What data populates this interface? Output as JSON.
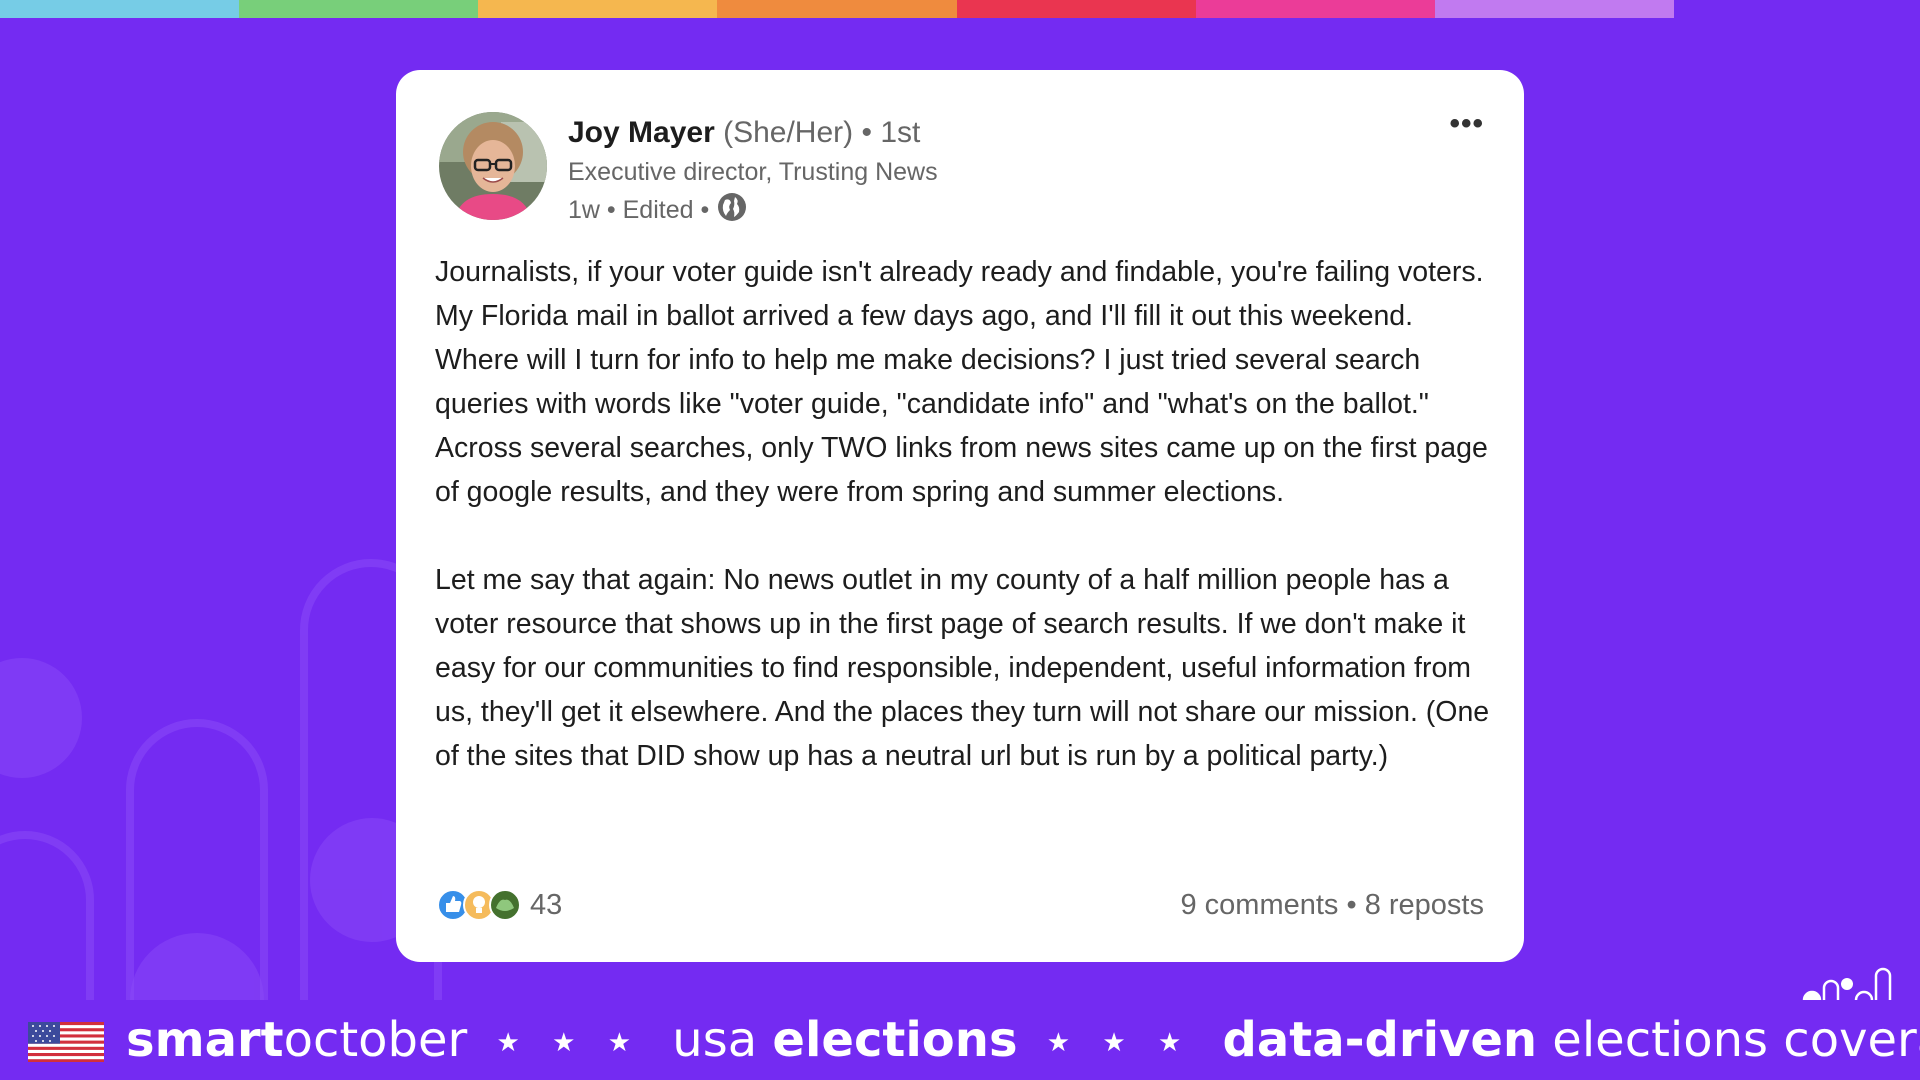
{
  "colors": {
    "background": "#742bf2",
    "card": "#ffffff",
    "rainbow": [
      "#76cce6",
      "#78cf7a",
      "#f5b74f",
      "#ef8b3e",
      "#ea3550",
      "#eb3c98",
      "#c17af0"
    ]
  },
  "post": {
    "author": {
      "name": "Joy Mayer",
      "pronouns": "(She/Her)",
      "degree": "1st",
      "headline": "Executive director, Trusting News"
    },
    "meta": {
      "time": "1w",
      "edited": "Edited"
    },
    "paragraphs": [
      "Journalists, if your voter guide isn't already ready and findable, you're failing voters. My Florida mail in ballot arrived a few days ago, and I'll fill it out this weekend. Where will I turn for info to help me make decisions? I just tried several search queries with words like \"voter guide, \"candidate info\" and \"what's on the ballot.\" Across several searches, only TWO links from news sites came up on the first page of google results, and they were from spring and summer elections.",
      "Let me say that again: No news outlet in my county of a half million people has a voter resource that shows up in the first page of search results. If we don't make it easy for our communities to find responsible, independent, useful information from us, they'll get it elsewhere. And the places they turn will not share our mission. (One of the sites that DID show up has a neutral url but is run by a political party.)"
    ],
    "reaction_count": "43",
    "reaction_icons": [
      "like-icon",
      "insightful-icon",
      "support-icon"
    ],
    "comments": "9 comments",
    "reposts": "8 reposts",
    "more_label": "•••"
  },
  "banner": {
    "smart": "smart",
    "october": "october",
    "stars": "★ ★ ★",
    "usa": "usa ",
    "elections": "elections",
    "data_driven": "data-driven",
    "coverage": " elections coverage"
  }
}
